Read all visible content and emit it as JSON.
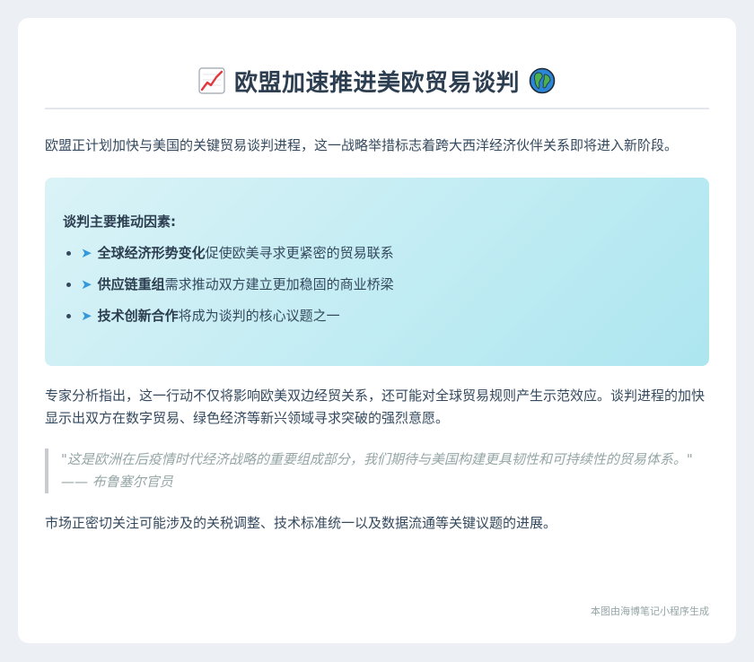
{
  "article": {
    "title": "欧盟加速推进美欧贸易谈判",
    "title_icons": [
      "chart-increasing-icon",
      "globe-icon"
    ],
    "intro": "欧盟正计划加快与美国的关键贸易谈判进程，这一战略举措标志着跨大西洋经济伙伴关系即将进入新阶段。",
    "drivers": {
      "title": "谈判主要推动因素:",
      "items": [
        {
          "arrow": "➤",
          "bold": "全球经济形势变化",
          "rest": "促使欧美寻求更紧密的贸易联系"
        },
        {
          "arrow": "➤",
          "bold": "供应链重组",
          "rest": "需求推动双方建立更加稳固的商业桥梁"
        },
        {
          "arrow": "➤",
          "bold": "技术创新合作",
          "rest": "将成为谈判的核心议题之一"
        }
      ]
    },
    "analysis": "专家分析指出，这一行动不仅将影响欧美双边经贸关系，还可能对全球贸易规则产生示范效应。谈判进程的加快显示出双方在数字贸易、绿色经济等新兴领域寻求突破的强烈意愿。",
    "quote": {
      "text": "\"这是欧洲在后疫情时代经济战略的重要组成部分，我们期待与美国构建更具韧性和可持续性的贸易体系。\"",
      "attribution": "—— 布鲁塞尔官员"
    },
    "closing": "市场正密切关注可能涉及的关税调整、技术标准统一以及数据流通等关键议题的进展。",
    "footer": "本图由海博笔记小程序生成"
  },
  "colors": {
    "background": "#eceff4",
    "card": "#ffffff",
    "title": "#2c3e50",
    "accent_arrow": "#3498db",
    "highlight_start": "#daf3f7",
    "highlight_end": "#ade6f0",
    "quote_text": "#95a5a6"
  }
}
